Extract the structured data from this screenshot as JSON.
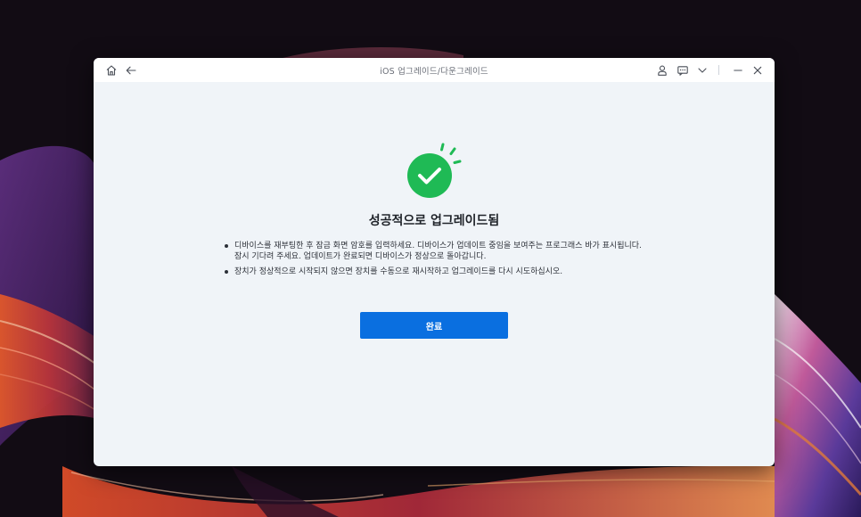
{
  "window": {
    "title": "iOS 업그레이드/다운그레이드",
    "titlebar_icons": [
      "home-icon",
      "back-arrow-icon",
      "account-icon",
      "feedback-icon",
      "chevron-down-icon",
      "minimize-icon",
      "close-icon"
    ]
  },
  "result": {
    "icon": "success-check-icon",
    "title": "성공적으로 업그레이드됨",
    "notes": [
      "디바이스를 재부팅한 후 잠금 화면 암호를 입력하세요. 디바이스가 업데이트 중임을 보여주는 프로그래스 바가  표시됩니다. 잠시 기다려 주세요. 업데이트가 완료되면 디바이스가 정상으로 돌아갑니다.",
      "장치가 정상적으로 시작되지 않으면 장치를 수동으로 재시작하고 업그레이드를 다시 시도하십시오."
    ],
    "done_label": "완료"
  },
  "colors": {
    "accent": "#0a6fe0",
    "success": "#1fba55",
    "window_bg": "#f0f4f8",
    "titlebar_bg": "#ffffff"
  }
}
